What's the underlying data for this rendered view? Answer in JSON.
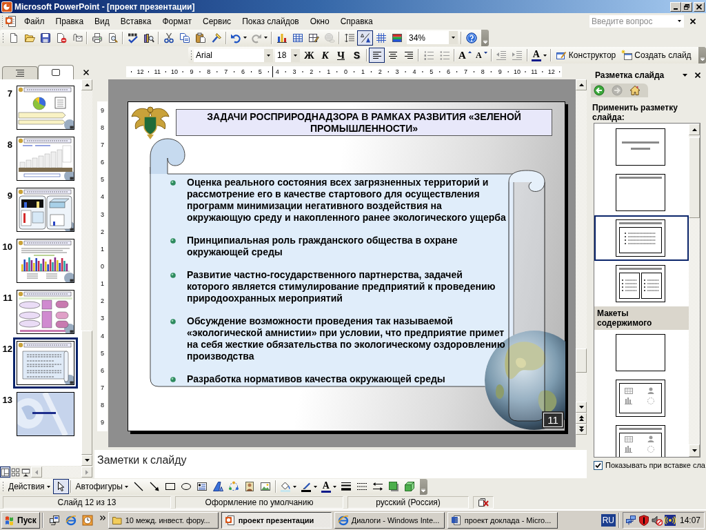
{
  "window": {
    "title": "Microsoft PowerPoint - [проект презентации]"
  },
  "menu": {
    "items": [
      "Файл",
      "Правка",
      "Вид",
      "Вставка",
      "Формат",
      "Сервис",
      "Показ слайдов",
      "Окно",
      "Справка"
    ],
    "ask": {
      "placeholder": "Введите вопрос"
    }
  },
  "standard_toolbar": {
    "buttons": [
      {
        "pressed": false,
        "disabled": false
      },
      {
        "pressed": false,
        "disabled": false
      },
      {
        "pressed": false,
        "disabled": false
      },
      {
        "pressed": false,
        "disabled": false
      },
      {
        "pressed": false,
        "disabled": false
      },
      {
        "pressed": false,
        "disabled": false
      },
      {
        "pressed": false,
        "disabled": false
      },
      {
        "pressed": false,
        "disabled": false
      },
      {
        "pressed": false,
        "disabled": false
      },
      {
        "pressed": false,
        "disabled": false
      },
      {
        "pressed": false,
        "disabled": false
      },
      {
        "pressed": false,
        "disabled": false
      },
      {
        "pressed": false,
        "disabled": false
      },
      {
        "pressed": false,
        "disabled": false
      },
      {
        "pressed": false,
        "disabled": true
      },
      {
        "pressed": false,
        "disabled": false
      },
      {
        "pressed": false,
        "disabled": false
      },
      {
        "pressed": false,
        "disabled": false
      },
      {
        "pressed": false,
        "disabled": true
      },
      {
        "pressed": false,
        "disabled": false
      },
      {
        "pressed": true,
        "disabled": false
      },
      {
        "pressed": false,
        "disabled": false
      },
      {
        "pressed": false,
        "disabled": false
      },
      {
        "pressed": false,
        "disabled": false
      }
    ],
    "zoom": "34%"
  },
  "formatting_toolbar": {
    "font": "Arial",
    "size": "18",
    "buttons": [
      {
        "label": "Ж",
        "pressed": false
      },
      {
        "label": "К",
        "pressed": false
      },
      {
        "label": "Ч",
        "pressed": false
      },
      {
        "label": "S",
        "pressed": false
      },
      {
        "pressed": true
      },
      {
        "pressed": false
      },
      {
        "pressed": false
      },
      {
        "pressed": false
      },
      {
        "pressed": false
      },
      {
        "label": "A",
        "pressed": false
      },
      {
        "label": "A",
        "pressed": false
      },
      {
        "pressed": false
      },
      {
        "pressed": false
      },
      {
        "label": "A",
        "pressed": false
      },
      {
        "label": "Конструктор",
        "pressed": false
      },
      {
        "label": "Создать слайд",
        "pressed": false
      }
    ]
  },
  "slide_pane": {
    "tabs": [
      {
        "selected": false
      },
      {
        "selected": true
      }
    ],
    "slides": [
      {
        "number": "7",
        "selected": false,
        "kind": "content"
      },
      {
        "number": "8",
        "selected": false,
        "kind": "content"
      },
      {
        "number": "9",
        "selected": false,
        "kind": "content"
      },
      {
        "number": "10",
        "selected": false,
        "kind": "content"
      },
      {
        "number": "11",
        "selected": false,
        "kind": "content"
      },
      {
        "number": "12",
        "selected": true,
        "kind": "content"
      },
      {
        "number": "13",
        "selected": false,
        "kind": "title"
      }
    ],
    "view_buttons": [
      {
        "selected": true
      },
      {
        "selected": false
      },
      {
        "selected": false
      }
    ]
  },
  "rulers": {
    "horizontal": [
      "12",
      "11",
      "10",
      "9",
      "8",
      "7",
      "6",
      "5",
      "4",
      "3",
      "2",
      "1",
      "0",
      "1",
      "2",
      "3",
      "4",
      "5",
      "6",
      "7",
      "8",
      "9",
      "10",
      "11",
      "12"
    ],
    "vertical": [
      "9",
      "8",
      "7",
      "6",
      "5",
      "4",
      "3",
      "2",
      "1",
      "0",
      "1",
      "2",
      "3",
      "4",
      "5",
      "6",
      "7",
      "8",
      "9"
    ]
  },
  "slide": {
    "title": "ЗАДАЧИ РОСПРИРОДНАДЗОРА В РАМКАХ РАЗВИТИЯ «ЗЕЛЕНОЙ ПРОМЫШЛЕННОСТИ»",
    "bullets": [
      "Оценка реального состояния всех загрязненных территорий и рассмотрение его в качестве стартового для осуществления программ минимизации негативного воздействия на окружающую среду и накопленного ранее экологического ущерба",
      "Принципиальная роль гражданского общества в охране окружающей среды",
      "Развитие частно-государственного партнерства, задачей которого является стимулирование предприятий к проведению природоохранных мероприятий",
      "Обсуждение возможности проведения так называемой «экологической амнистии» при условии, что предприятие примет на себя жесткие обязательства по экологическому оздоровлению производства",
      "Разработка нормативов качества окружающей среды"
    ],
    "number": "11"
  },
  "notes": {
    "placeholder": "Заметки к слайду"
  },
  "task_pane": {
    "title": "Разметка слайда",
    "nav": [
      {
        "disabled": false
      },
      {
        "disabled": true
      },
      {
        "disabled": false
      }
    ],
    "heading": "Применить разметку слайда:",
    "layouts": [
      {
        "kind": "title",
        "selected": false
      },
      {
        "kind": "titleonly",
        "selected": false
      },
      {
        "kind": "bullets",
        "selected": true
      },
      {
        "kind": "columns",
        "selected": false
      }
    ],
    "section": "Макеты содержимого",
    "content_layouts": [
      {
        "kind": "blank",
        "selected": false
      },
      {
        "kind": "content",
        "selected": false
      },
      {
        "kind": "titlecontent",
        "selected": false
      }
    ],
    "show_on_insert": {
      "label": "Показывать при вставке сла",
      "checked": true
    }
  },
  "drawing_toolbar": {
    "buttons": [
      {
        "label": "Действия",
        "pressed": false
      },
      {
        "pressed": true
      },
      {
        "label": "Автофигуры",
        "pressed": false
      },
      {
        "pressed": false
      },
      {
        "pressed": false
      },
      {
        "pressed": false
      },
      {
        "pressed": false
      },
      {
        "pressed": false
      },
      {
        "pressed": false
      },
      {
        "pressed": false
      },
      {
        "pressed": false
      },
      {
        "pressed": false
      },
      {
        "pressed": false
      },
      {
        "pressed": false
      },
      {
        "label": "A",
        "pressed": false
      },
      {
        "pressed": false
      },
      {
        "pressed": false
      },
      {
        "pressed": false
      },
      {
        "pressed": false
      },
      {
        "pressed": false
      }
    ]
  },
  "status_bar": {
    "slide": "Слайд 12 из 13",
    "design": "Оформление по умолчанию",
    "language": "русский (Россия)"
  },
  "taskbar": {
    "start": "Пуск",
    "tasks": [
      {
        "label": "10 межд. инвест. фору...",
        "selected": false
      },
      {
        "label": "проект презентации",
        "selected": true
      },
      {
        "label": "Диалоги - Windows Inte...",
        "selected": false
      },
      {
        "label": "проект доклада - Micro...",
        "selected": false
      }
    ],
    "language": "RU",
    "clock": "14:07"
  }
}
